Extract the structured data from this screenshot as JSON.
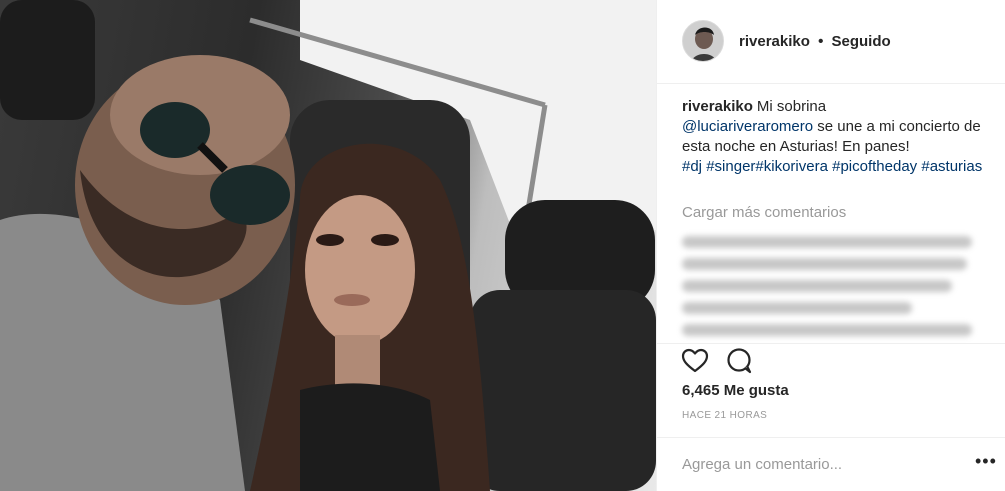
{
  "post": {
    "username": "riverakiko",
    "follow_status": "Seguido",
    "separator": "•",
    "caption": {
      "username": "riverakiko",
      "text_1": "Mi sobrina",
      "mention": "@luciariveraromero",
      "text_2": " se une a mi concierto de esta noche en Asturias! En panes! ",
      "hashtag_dj": "#dj",
      "hashtag_singer": "#singer",
      "hashtag_kikorivera": "#kikorivera",
      "hashtag_picoftheday": "#picoftheday",
      "hashtag_asturias": "#asturias"
    },
    "load_more_comments": "Cargar más comentarios",
    "likes": "6,465 Me gusta",
    "timestamp": "HACE 21 HORAS",
    "comment_placeholder": "Agrega un comentario...",
    "more_options": "•••"
  },
  "icons": {
    "like": "heart-icon",
    "comment": "comment-icon",
    "more": "more-options-icon"
  },
  "colors": {
    "text": "#262626",
    "link": "#003569",
    "muted": "#999999",
    "border": "#efefef"
  }
}
